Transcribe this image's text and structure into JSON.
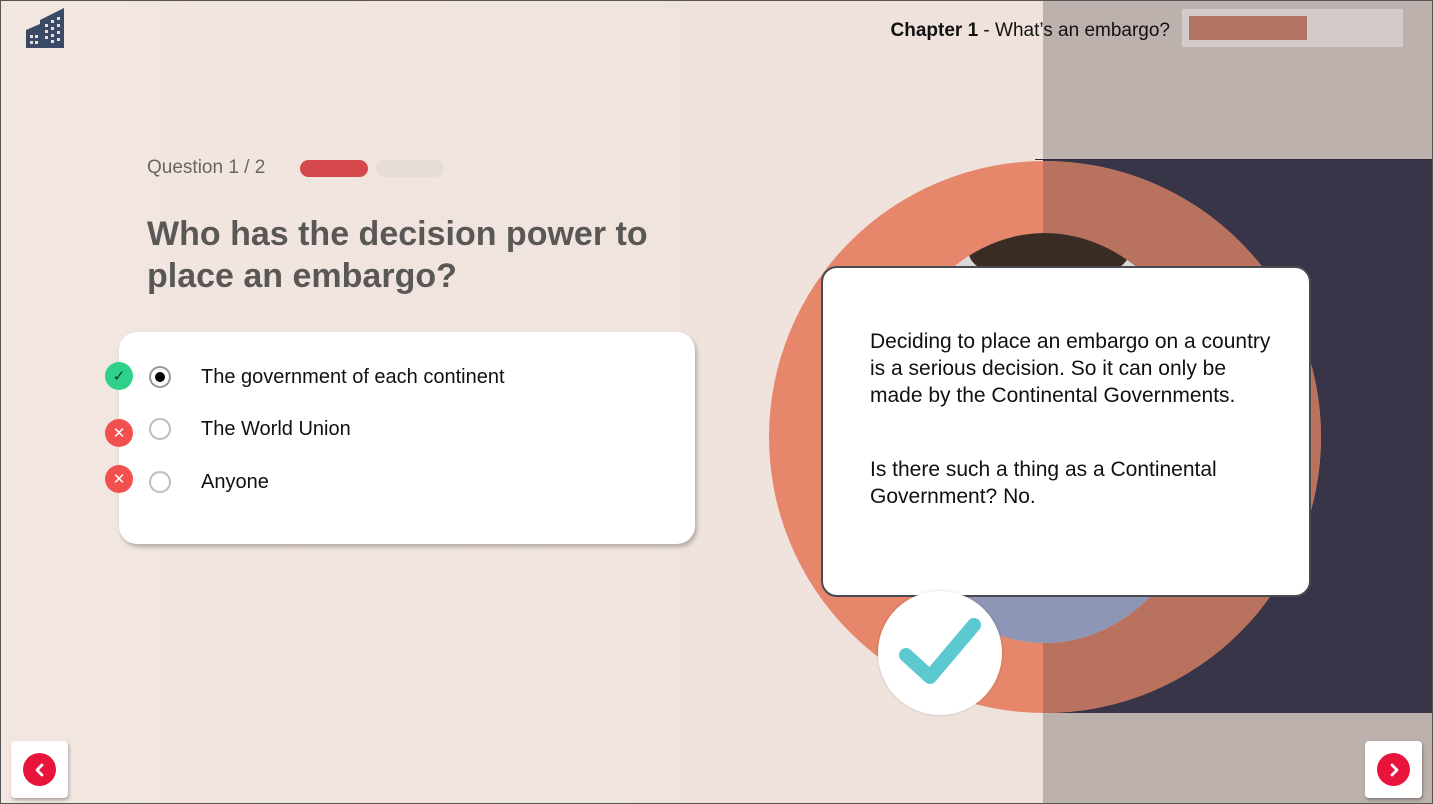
{
  "header": {
    "chapter_label": "Chapter 1",
    "chapter_title": " - What’s an embargo?",
    "progress_fraction": 0.57
  },
  "question": {
    "counter": "Question 1 / 2",
    "title": "Who has the decision power to place an embargo?",
    "answers": [
      {
        "label": "The government of each continent",
        "status": "correct",
        "selected": true
      },
      {
        "label": "The World Union",
        "status": "incorrect",
        "selected": false
      },
      {
        "label": "Anyone",
        "status": "incorrect",
        "selected": false
      }
    ]
  },
  "feedback": {
    "paragraph1": "Deciding to place an embargo on a country is a serious decision. So it can only be made by the Continental Governments.",
    "paragraph2": "Is there such a thing as a Continental Government? No."
  },
  "icons": {
    "logo": "building-logo-icon",
    "correct": "check-icon",
    "incorrect": "cross-icon",
    "prev": "chevron-left-icon",
    "next": "chevron-right-icon"
  },
  "colors": {
    "accent_red": "#e8143c",
    "progress_fill": "#b37362",
    "correct_green": "#2fd08a",
    "incorrect_red": "#f2504f",
    "ring_orange": "#e6866a",
    "check_teal": "#5cc8d0"
  }
}
